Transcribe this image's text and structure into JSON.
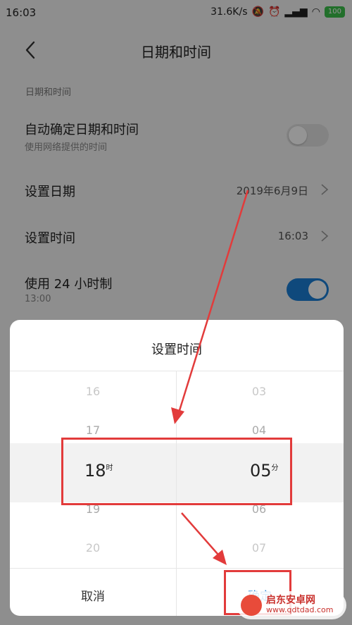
{
  "status": {
    "time": "16:03",
    "speed": "31.6K/s",
    "battery": "100"
  },
  "header": {
    "title": "日期和时间"
  },
  "section": {
    "label": "日期和时间"
  },
  "settings": {
    "auto": {
      "label": "自动确定日期和时间",
      "sub": "使用网络提供的时间"
    },
    "date": {
      "label": "设置日期",
      "value": "2019年6月9日"
    },
    "time": {
      "label": "设置时间",
      "value": "16:03"
    },
    "h24": {
      "label": "使用 24 小时制",
      "sub": "13:00"
    }
  },
  "dialog": {
    "title": "设置时间",
    "hours": [
      "16",
      "17",
      "18",
      "19",
      "20"
    ],
    "minutes": [
      "03",
      "04",
      "05",
      "06",
      "07"
    ],
    "selected": {
      "hour": "18",
      "hour_unit": "时",
      "minute": "05",
      "minute_unit": "分"
    },
    "cancel": "取消",
    "confirm": "确定"
  },
  "watermark": {
    "name": "启东安卓网",
    "url": "www.qdtdad.com"
  },
  "colors": {
    "accent": "#1a7fd6",
    "annotation": "#e23b3b",
    "toggle_off": "#e2e2e2"
  }
}
